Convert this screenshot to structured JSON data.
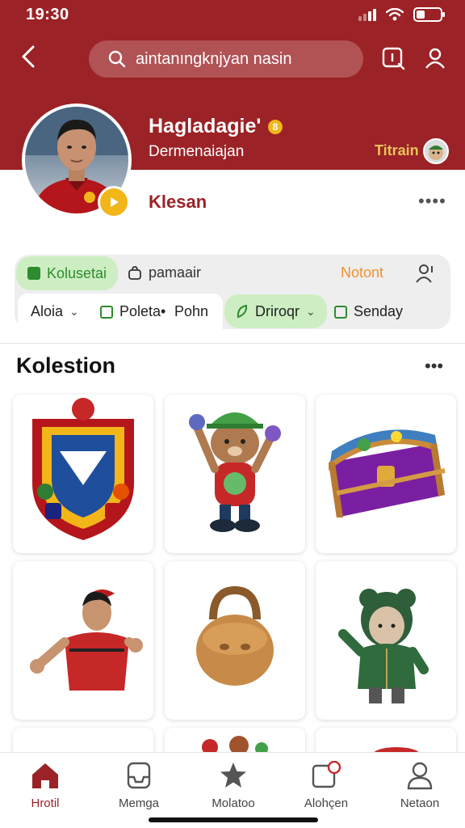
{
  "status": {
    "time": "19:30"
  },
  "search": {
    "placeholder": "aintanıngknjyan nasin"
  },
  "profile": {
    "name": "Hagladagie'",
    "subtitle": "Dermenaiajan",
    "tracker_label": "Titrain",
    "action_label": "Klesan",
    "more": "••••"
  },
  "filters": {
    "row1": [
      {
        "label": "Kolusetai",
        "style": "green"
      },
      {
        "label": "pamaair",
        "style": "plain"
      },
      {
        "label": "Notont",
        "style": "accent"
      }
    ],
    "row2": [
      {
        "label": "Aloia",
        "has_chevron": true
      },
      {
        "label": "Poleta•",
        "has_chevron": false
      },
      {
        "label": "Pohn",
        "has_chevron": false
      },
      {
        "label": "Driroqr",
        "has_chevron": true
      },
      {
        "label": "Senday",
        "has_chevron": false
      }
    ]
  },
  "section": {
    "title": "Kolestion",
    "more": "•••"
  },
  "grid": {
    "items": [
      {
        "icon": "team-crest-icon"
      },
      {
        "icon": "bear-mascot-icon"
      },
      {
        "icon": "treasure-chest-icon"
      },
      {
        "icon": "football-player-icon"
      },
      {
        "icon": "leather-bag-icon"
      },
      {
        "icon": "green-hoodie-figure-icon"
      }
    ]
  },
  "nav": [
    {
      "label": "Hrotil",
      "icon": "home-icon",
      "active": true
    },
    {
      "label": "Memga",
      "icon": "inbox-icon",
      "active": false
    },
    {
      "label": "Molatoo",
      "icon": "star-icon",
      "active": false
    },
    {
      "label": "Alohçen",
      "icon": "notification-icon",
      "active": false
    },
    {
      "label": "Netaon",
      "icon": "user-icon",
      "active": false
    }
  ],
  "colors": {
    "brand": "#9b2226",
    "accent": "#f2b619",
    "green": "#2e8b2e",
    "orange": "#f0912f"
  }
}
